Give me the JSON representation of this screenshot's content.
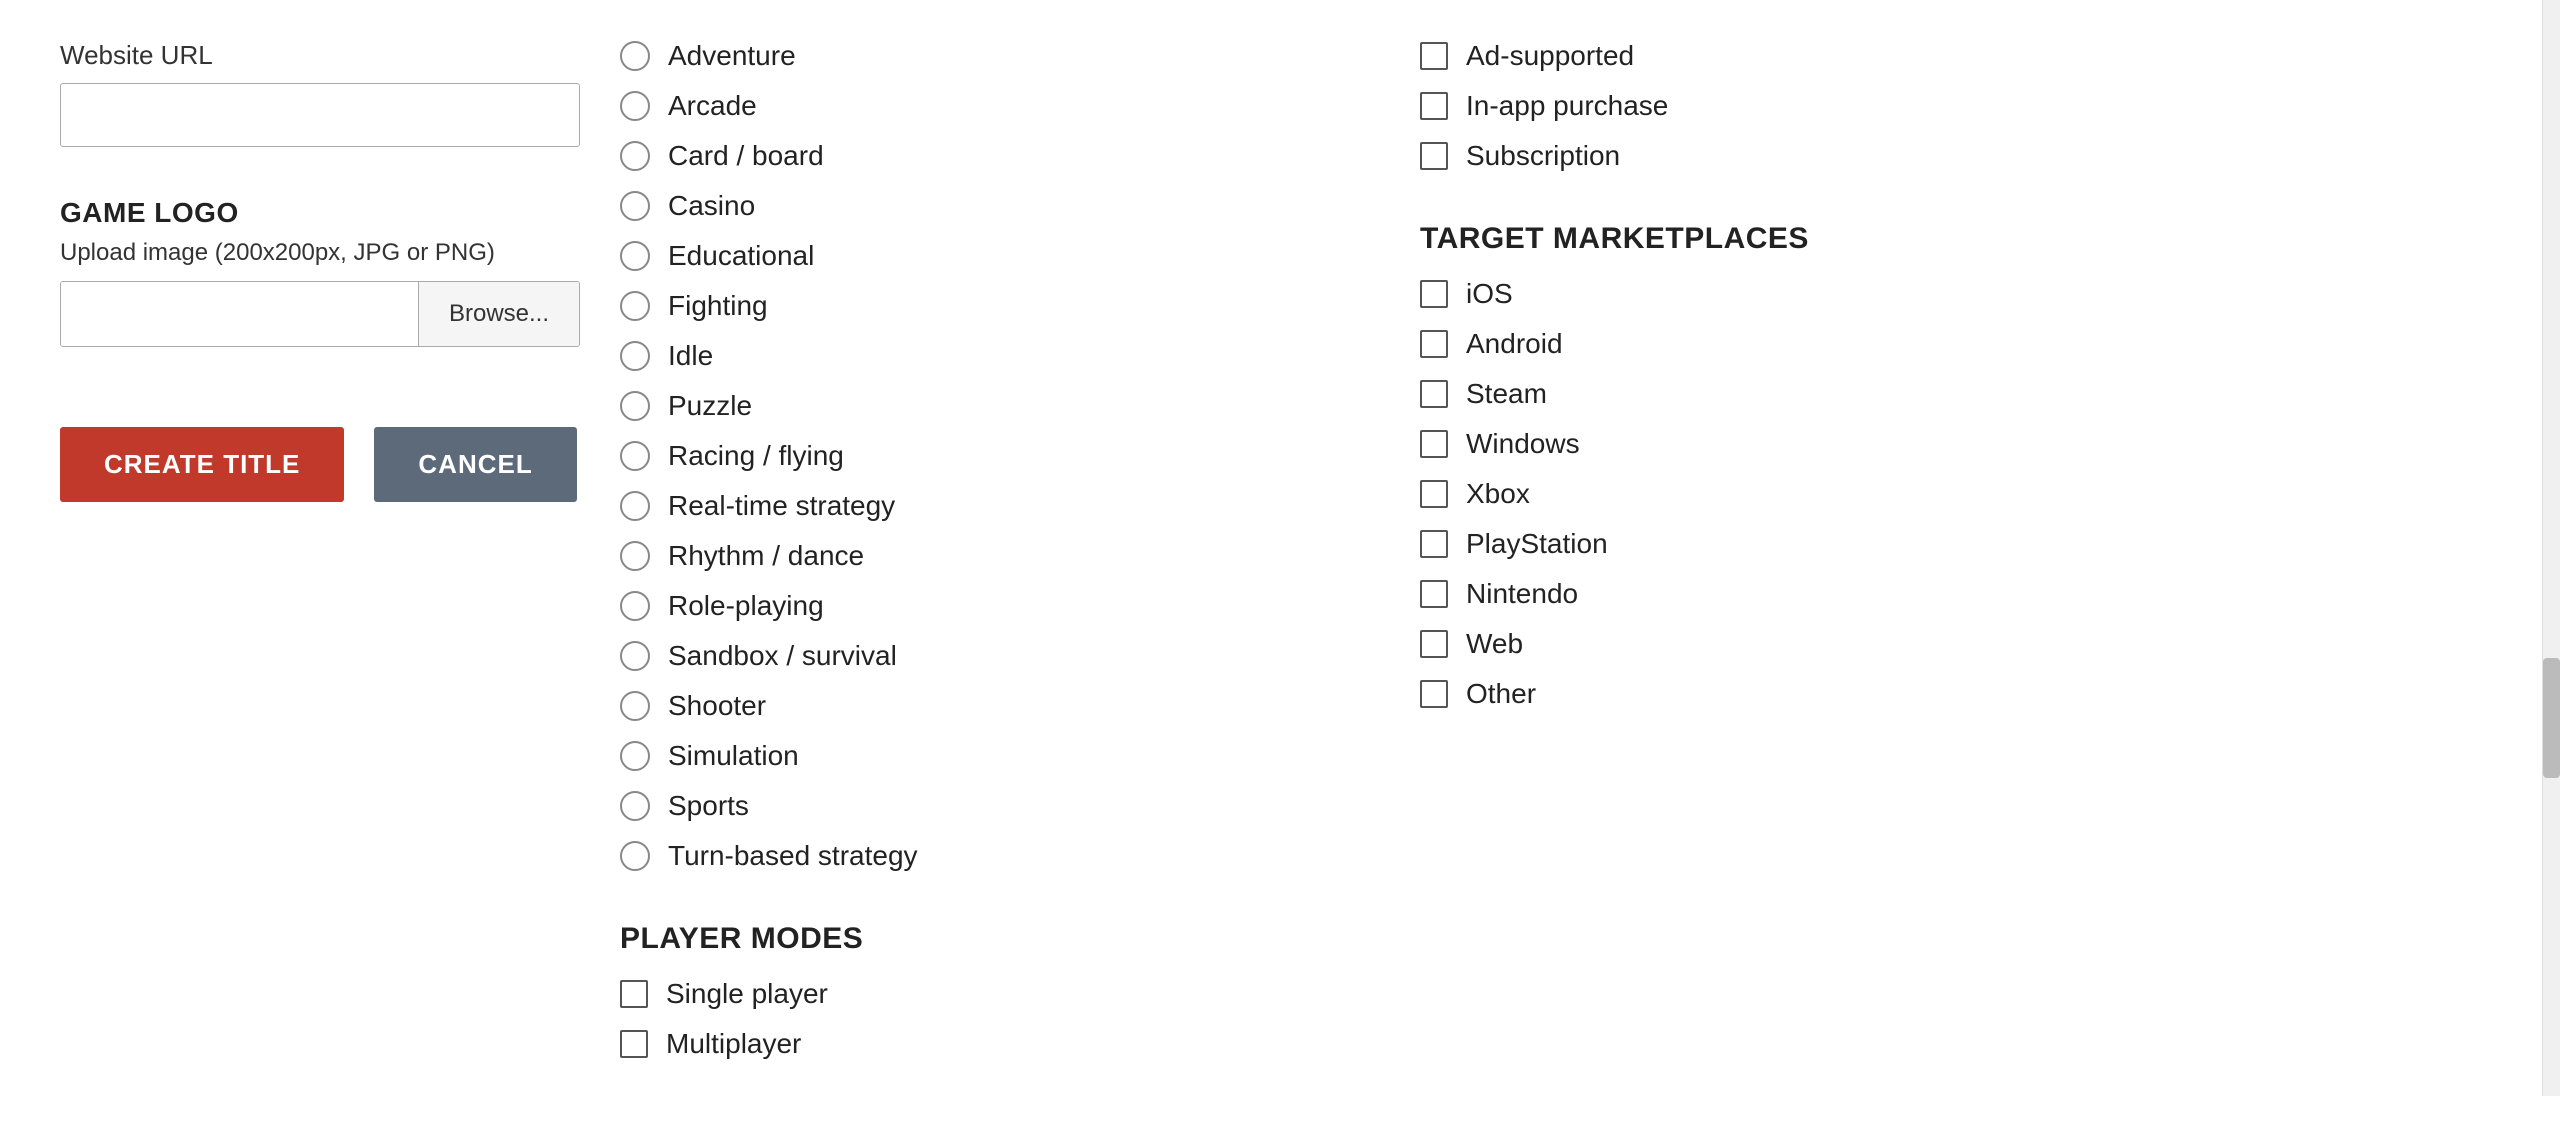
{
  "left_col": {
    "website_url_label": "Website URL",
    "website_url_value": "",
    "game_logo_title": "GAME LOGO",
    "upload_hint": "Upload image (200x200px, JPG or PNG)",
    "browse_btn_label": "Browse...",
    "file_input_value": ""
  },
  "buttons": {
    "create_label": "CREATE TITLE",
    "cancel_label": "CANCEL"
  },
  "middle_col": {
    "genres": [
      "Adventure",
      "Arcade",
      "Card / board",
      "Casino",
      "Educational",
      "Fighting",
      "Idle",
      "Puzzle",
      "Racing / flying",
      "Real-time strategy",
      "Rhythm / dance",
      "Role-playing",
      "Sandbox / survival",
      "Shooter",
      "Simulation",
      "Sports",
      "Turn-based strategy"
    ],
    "player_modes_title": "PLAYER MODES",
    "player_modes": [
      "Single player",
      "Multiplayer"
    ]
  },
  "right_col": {
    "monetization_items": [
      "Ad-supported",
      "In-app purchase",
      "Subscription"
    ],
    "target_marketplaces_title": "TARGET MARKETPLACES",
    "marketplaces": [
      "iOS",
      "Android",
      "Steam",
      "Windows",
      "Xbox",
      "PlayStation",
      "Nintendo",
      "Web",
      "Other"
    ]
  }
}
